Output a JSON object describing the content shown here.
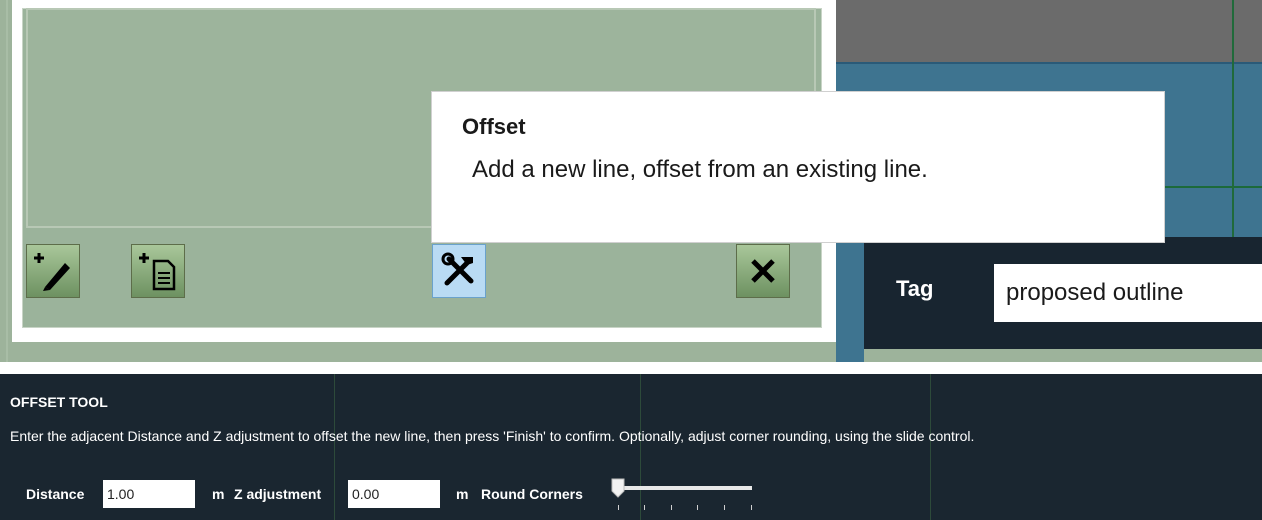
{
  "tooltip": {
    "title": "Offset",
    "description": "Add a new line, offset from an existing line."
  },
  "toolbar": {
    "add_line_icon": "add-pencil-icon",
    "add_document_icon": "add-document-icon",
    "tools_icon": "hammer-wrench-icon",
    "delete_icon": "close-x-icon"
  },
  "tag": {
    "label": "Tag",
    "value": "proposed outline"
  },
  "offset_tool": {
    "title": "OFFSET TOOL",
    "instructions": "Enter the adjacent Distance and Z adjustment to offset the new line, then press 'Finish' to confirm. Optionally, adjust corner rounding, using the slide control.",
    "distance_label": "Distance",
    "distance_value": "1.00",
    "distance_unit": "m",
    "z_label": "Z adjustment",
    "z_value": "0.00",
    "z_unit": "m",
    "round_corners_label": "Round Corners",
    "round_corners_level": 0
  },
  "colors": {
    "panel_green": "#9db39b",
    "button_green": "#8fb07f",
    "selected_button": "#b9dbf4",
    "dark_panel": "#1a2630",
    "map_blue": "#3e7490"
  }
}
